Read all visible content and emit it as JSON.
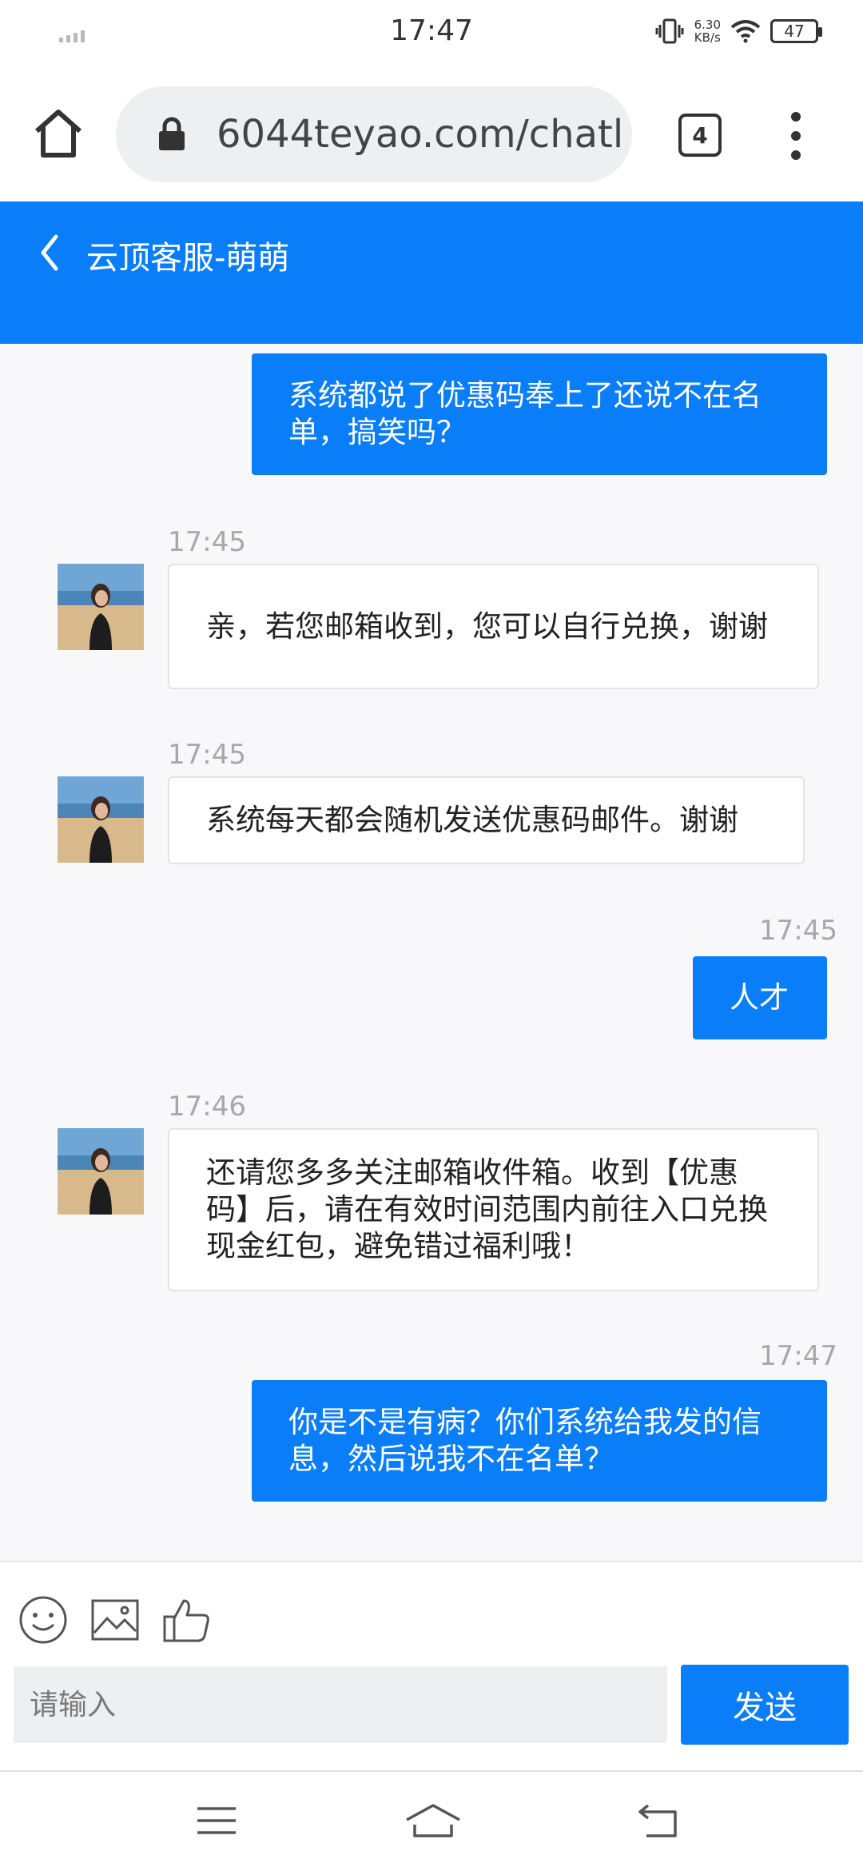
{
  "status_bar": {
    "time": "17:47",
    "net_speed_value": "6.30",
    "net_speed_unit": "KB/s",
    "battery": "47"
  },
  "browser": {
    "url": "6044teyao.com/chatl",
    "tab_count": "4"
  },
  "chat_header": {
    "title": "云顶客服-萌萌"
  },
  "messages": [
    {
      "type": "sent",
      "text": "系统都说了优惠码奉上了还说不在名单，搞笑吗？"
    },
    {
      "type": "received",
      "time": "17:45",
      "text": "亲，若您邮箱收到，您可以自行兑换，谢谢"
    },
    {
      "type": "received",
      "time": "17:45",
      "text": "系统每天都会随机发送优惠码邮件。谢谢"
    },
    {
      "type": "sent",
      "time": "17:45",
      "text": "人才"
    },
    {
      "type": "received",
      "time": "17:46",
      "text": "还请您多多关注邮箱收件箱。收到【优惠码】后，请在有效时间范围内前往入口兑换现金红包，避免错过福利哦！"
    },
    {
      "type": "sent",
      "time": "17:47",
      "text": "你是不是有病？你们系统给我发的信息，然后说我不在名单？"
    }
  ],
  "composer": {
    "placeholder": "请输入",
    "send_label": "发送",
    "tools": [
      "emoji-icon",
      "image-icon",
      "thumbs-up-icon"
    ]
  },
  "colors": {
    "accent": "#0a7df8",
    "chat_background": "#f8f8fa",
    "timestamp": "#a8a8a8"
  }
}
